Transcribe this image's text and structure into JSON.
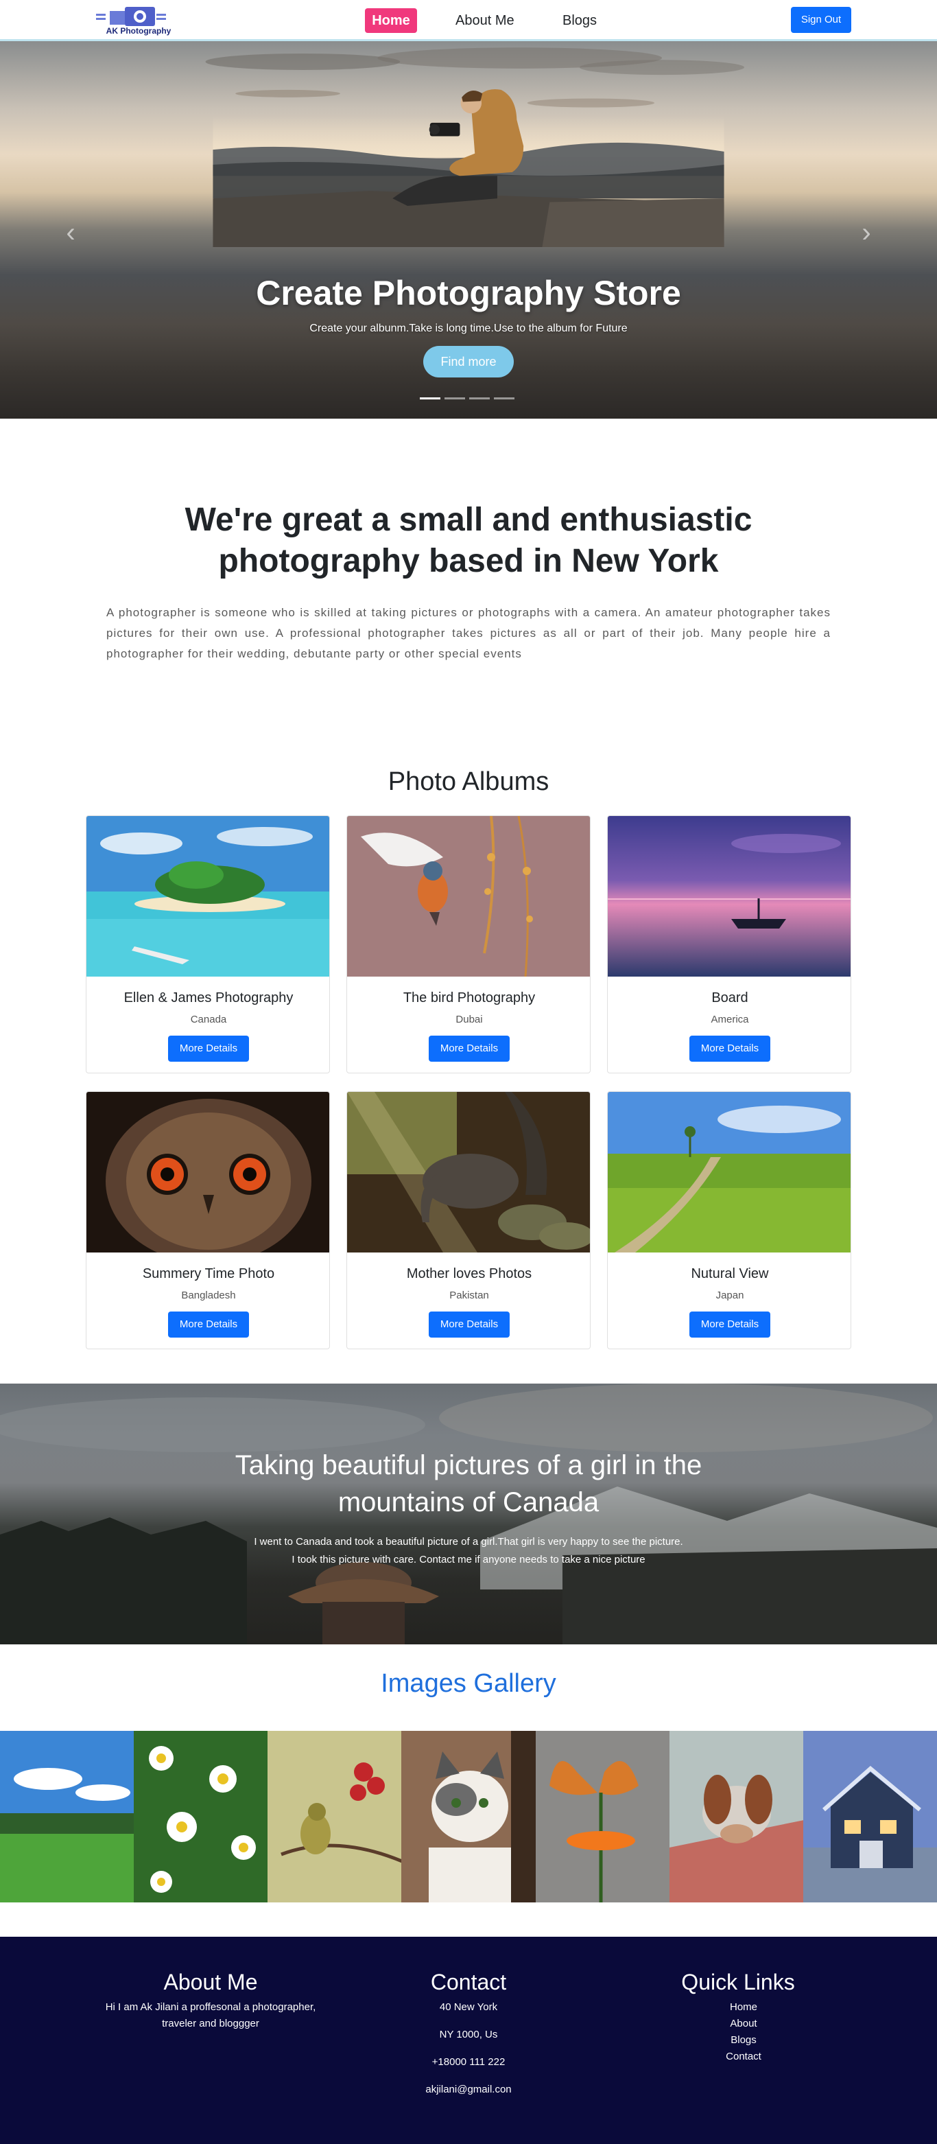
{
  "nav": {
    "logo_text": "AK Photography",
    "items": [
      {
        "label": "Home",
        "active": true
      },
      {
        "label": "About Me",
        "active": false
      },
      {
        "label": "Blogs",
        "active": false
      }
    ],
    "signout_label": "Sign Out"
  },
  "hero": {
    "title": "Create Photography Store",
    "subtitle": "Create your albunm.Take is long time.Use to the album for Future",
    "button_label": "Find more",
    "slide_count": 4,
    "active_slide": 1,
    "prev_icon": "chevron-left-icon",
    "next_icon": "chevron-right-icon"
  },
  "intro": {
    "heading": "We're great a small and enthusiastic photography based in New York",
    "body": "A photographer is someone who is skilled at taking pictures or photographs with a camera. An amateur photographer takes pictures for their own use. A professional photographer takes pictures as all or part of their job. Many people hire a photographer for their wedding, debutante party or other special events"
  },
  "albums": {
    "title": "Photo Albums",
    "button_label": "More Details",
    "cards": [
      {
        "title": "Ellen & James Photography",
        "location": "Canada"
      },
      {
        "title": "The bird Photography",
        "location": "Dubai"
      },
      {
        "title": "Board",
        "location": "America"
      },
      {
        "title": "Summery Time Photo",
        "location": "Bangladesh"
      },
      {
        "title": "Mother loves Photos",
        "location": "Pakistan"
      },
      {
        "title": "Nutural View",
        "location": "Japan"
      }
    ]
  },
  "banner": {
    "title": "Taking beautiful pictures of a girl in the mountains of Canada",
    "line1": "I went to Canada and took a beautiful picture of a girl.That girl is very happy to see the picture.",
    "line2": "I took this picture with care. Contact me if anyone needs to take a nice picture"
  },
  "gallery": {
    "title": "Images Gallery"
  },
  "footer": {
    "about": {
      "title": "About Me",
      "text": "Hi I am Ak Jilani a proffesonal a photographer, traveler and bloggger"
    },
    "contact": {
      "title": "Contact",
      "address1": "40 New York",
      "address2": "NY 1000, Us",
      "phone": "+18000 111 222",
      "email": "akjilani@gmail.con"
    },
    "links": {
      "title": "Quick Links",
      "items": [
        "Home",
        "About",
        "Blogs",
        "Contact"
      ]
    }
  },
  "colors": {
    "primary": "#0d6efd",
    "home_active": "#f0387c",
    "footer_bg": "#0a0a3a",
    "gallery_title": "#1f6fdc",
    "hero_button": "#7ec9ea"
  }
}
